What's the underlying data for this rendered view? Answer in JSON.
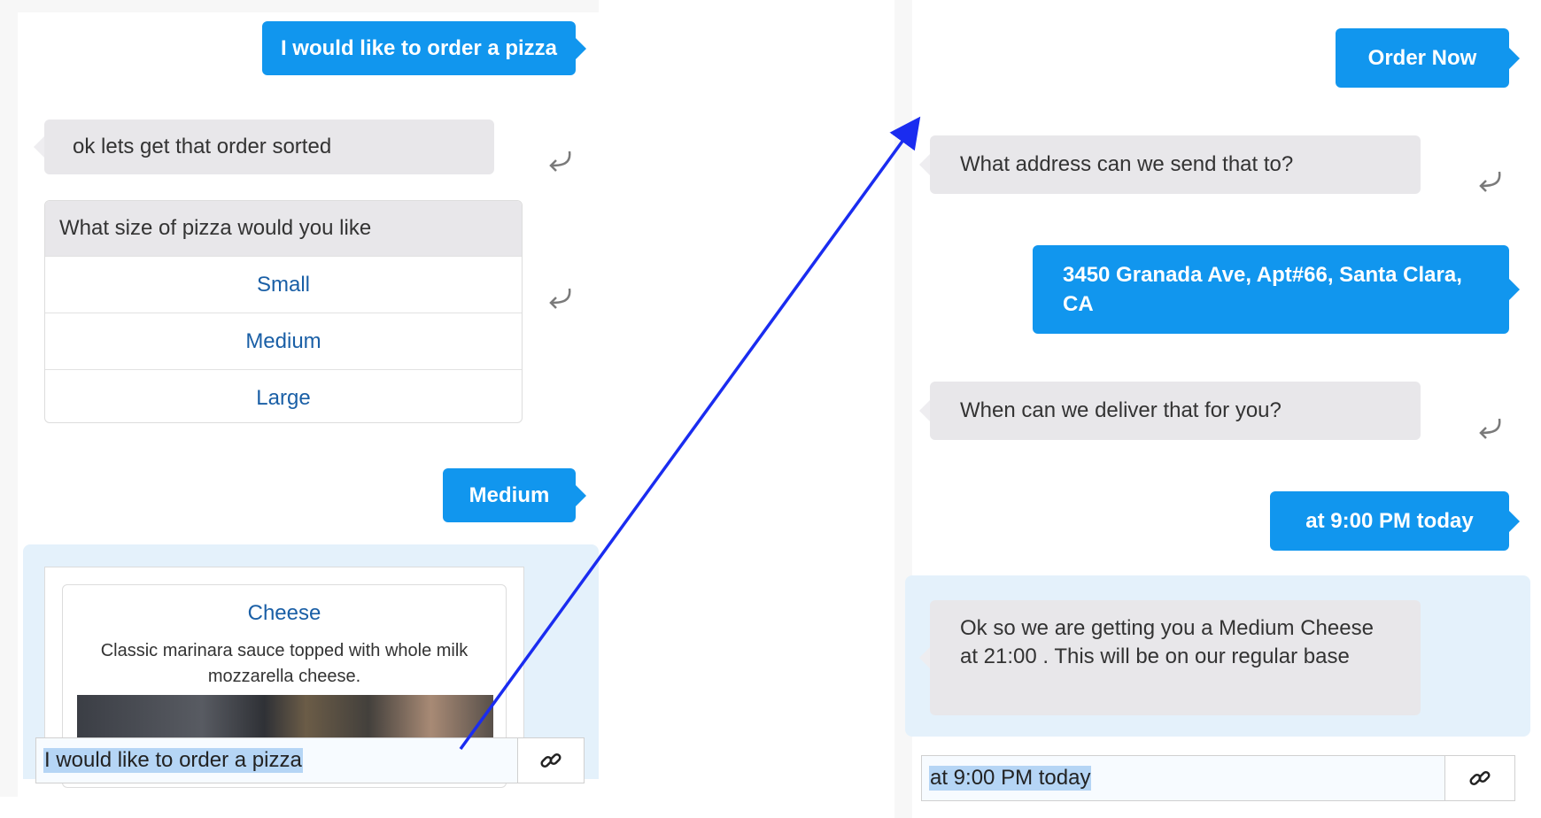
{
  "left_chat": {
    "user_message_1": "I would like to order a pizza",
    "bot_message_1": "ok lets get that order sorted",
    "size_prompt": "What size of pizza would you like",
    "size_options": [
      "Small",
      "Medium",
      "Large"
    ],
    "user_message_2": "Medium",
    "card": {
      "title": "Cheese",
      "description": "Classic marinara sauce topped with whole milk mozzarella cheese."
    },
    "input_value": "I would like to order a pizza"
  },
  "right_chat": {
    "user_message_1": "Order Now",
    "bot_message_1": "What address can we send that to?",
    "user_message_2": "3450 Granada Ave, Apt#66, Santa Clara, CA",
    "bot_message_2": "When can we deliver that for you?",
    "user_message_3": "at 9:00 PM today",
    "bot_message_3": "Ok so we are getting you a Medium Cheese at 21:00 . This will be on our regular base",
    "input_value": "at 9:00 PM today"
  },
  "icons": {
    "reply": "reply-icon",
    "attach": "link-icon",
    "arrow": "arrow-annotation"
  },
  "colors": {
    "user_bubble": "#1196ee",
    "bot_bubble": "#e8e7ea",
    "option_text": "#1a5fa6",
    "annotation_arrow": "#1a2cf0",
    "highlight": "#b5d5f5"
  }
}
